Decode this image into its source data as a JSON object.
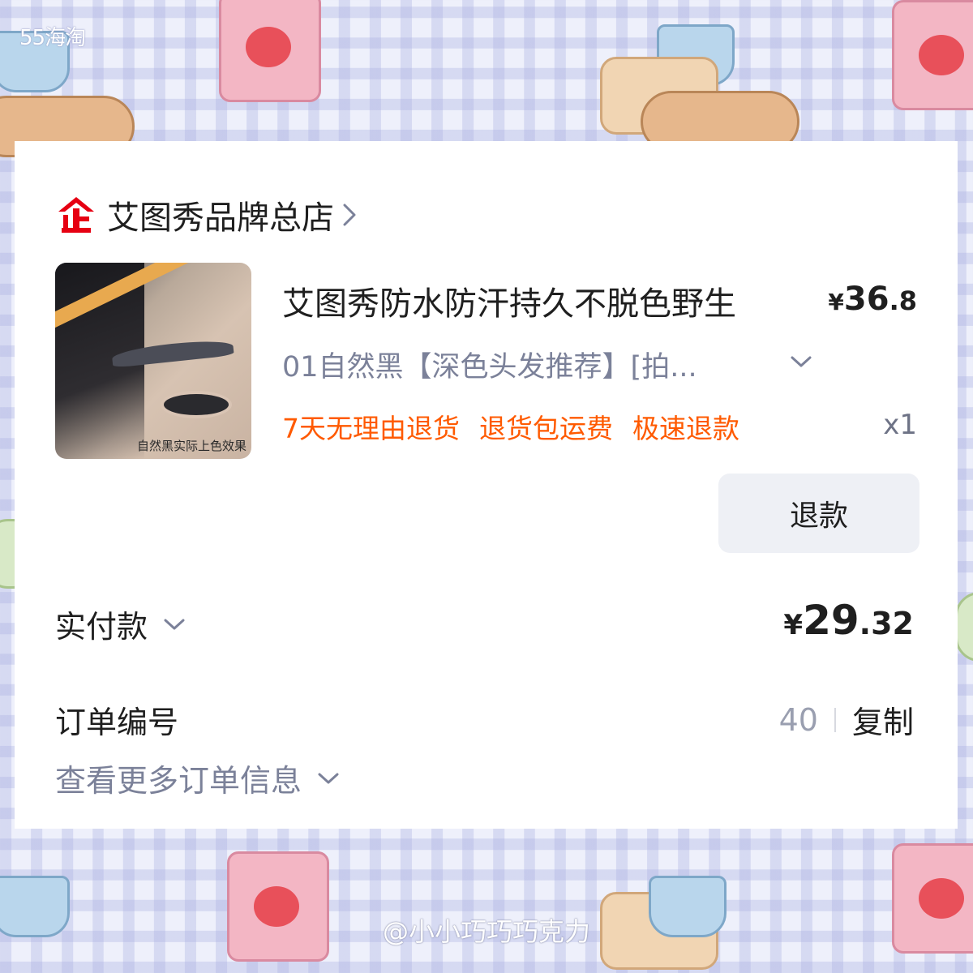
{
  "watermarks": {
    "top_left": "55海淘",
    "bottom": "@小小巧巧巧克力"
  },
  "colors": {
    "accent_orange": "#ff5a00",
    "shop_logo_red": "#e60012",
    "text_primary": "#1f1f1f",
    "text_secondary": "#7b8199"
  },
  "shop": {
    "logo_icon": "tmall-flagship-icon",
    "name": "艾图秀品牌总店"
  },
  "product": {
    "image_caption": "自然黑实际上色效果",
    "title": "艾图秀防水防汗持久不脱色野生",
    "price": {
      "currency": "¥",
      "integer": "36",
      "decimal": ".8"
    },
    "sku": "01自然黑【深色头发推荐】[拍...",
    "services": [
      "7天无理由退货",
      "退货包运费",
      "极速退款"
    ],
    "quantity": "x1",
    "refund_button": "退款"
  },
  "payment": {
    "label": "实付款",
    "amount": {
      "currency": "¥",
      "integer": "29",
      "decimal": ".32"
    }
  },
  "order": {
    "number_label": "订单编号",
    "number_visible": "40",
    "copy_label": "复制",
    "more_info_label": "查看更多订单信息"
  }
}
